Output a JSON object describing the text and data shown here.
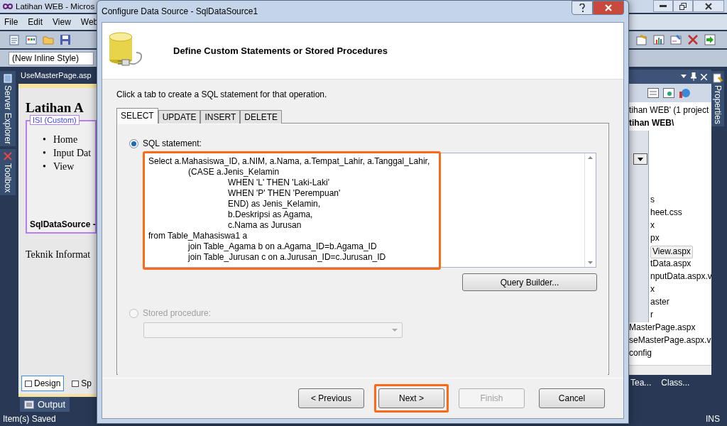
{
  "ide": {
    "title": "Latihan WEB - Micros",
    "menu": [
      "File",
      "Edit",
      "View",
      "Web"
    ],
    "style_box": "(New Inline Style)",
    "side_tabs_left": [
      "Server Explorer",
      "Toolbox"
    ],
    "side_tabs_right": [
      "Properties"
    ],
    "document_tab": "UseMasterPage.asp",
    "design": {
      "heading": "Latihan A",
      "content_label": "ISI (Custom)",
      "links": [
        {
          "marker": "•",
          "label": "Home"
        },
        {
          "marker": "•",
          "label": "Input Dat"
        },
        {
          "marker": "•",
          "label": "View"
        }
      ],
      "datasource": "SqlDataSource -",
      "footer_text": "Teknik Informat"
    },
    "view_tabs": [
      {
        "label": "Design",
        "selected": true
      },
      {
        "label": "Sp",
        "selected": false
      }
    ],
    "solution_explorer": {
      "header_lines": [
        "tihan WEB' (1 project",
        "tihan WEB\\"
      ],
      "items": [
        {
          "label": "s",
          "selected": false
        },
        {
          "label": "heet.css",
          "selected": false
        },
        {
          "label": "x",
          "selected": false
        },
        {
          "label": "px",
          "selected": false
        },
        {
          "label": "View.aspx",
          "selected": true
        },
        {
          "label": "tData.aspx",
          "selected": false
        },
        {
          "label": "nputData.aspx.v",
          "selected": false
        },
        {
          "label": "x",
          "selected": false
        },
        {
          "label": "aster",
          "selected": false
        },
        {
          "label": "r",
          "selected": false
        },
        {
          "label": "MasterPage.aspx",
          "selected": false
        },
        {
          "label": "seMasterPage.aspx.v",
          "selected": false
        },
        {
          "label": "config",
          "selected": false
        }
      ]
    },
    "bottom_tabs": [
      "Tea...",
      "Class..."
    ],
    "output_button": "Output",
    "status": {
      "message": "Item(s) Saved",
      "mode": "INS"
    }
  },
  "dialog": {
    "title": "Configure Data Source - SqlDataSource1",
    "heading": "Define Custom Statements or Stored Procedures",
    "instruction": "Click a tab to create a SQL statement for that operation.",
    "tabs": [
      {
        "label": "SELECT",
        "selected": true
      },
      {
        "label": "UPDATE",
        "selected": false
      },
      {
        "label": "INSERT",
        "selected": false
      },
      {
        "label": "DELETE",
        "selected": false
      }
    ],
    "options": [
      {
        "kind": "sql",
        "label": "SQL statement:",
        "selected": true,
        "disabled": false,
        "highlighted": true,
        "button": "Query Builder...",
        "text": "Select a.Mahasiswa_ID, a.NIM, a.Nama, a.Tempat_Lahir, a.Tanggal_Lahir,\n\t(CASE a.Jenis_Kelamin\n\t\tWHEN 'L' THEN 'Laki-Laki'\n\t\tWHEN 'P' THEN 'Perempuan'\n\t\tEND) as Jenis_Kelamin,\n\t\tb.Deskripsi as Agama,\n\t\tc.Nama as Jurusan\nfrom Table_Mahasiswa1 a\n\tjoin Table_Agama b on a.Agama_ID=b.Agama_ID\n\tjoin Table_Jurusan c on a.Jurusan_ID=c.Jurusan_ID"
      },
      {
        "kind": "procedure",
        "label": "Stored procedure:",
        "selected": false,
        "disabled": true
      }
    ],
    "buttons": [
      {
        "label": "< Previous",
        "disabled": false,
        "highlighted": false
      },
      {
        "label": "Next >",
        "disabled": false,
        "highlighted": true
      },
      {
        "label": "Finish",
        "disabled": true,
        "highlighted": false
      },
      {
        "label": "Cancel",
        "disabled": false,
        "highlighted": false
      }
    ]
  }
}
